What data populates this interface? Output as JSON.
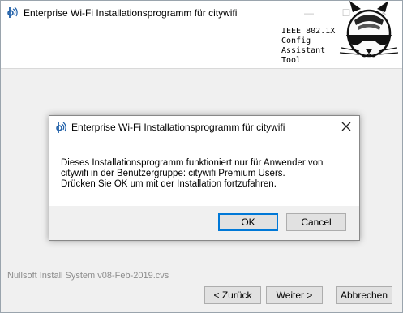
{
  "window": {
    "title": "Enterprise Wi-Fi Installationsprogramm für citywifi",
    "banner_lines": [
      "IEEE 802.1X",
      "Config",
      "Assistant",
      "Tool"
    ],
    "controls": {
      "minimize": "—",
      "maximize": "☐",
      "close": "✕"
    }
  },
  "dialog": {
    "title": "Enterprise Wi-Fi Installationsprogramm für citywifi",
    "message_lines": [
      "Dieses Installationsprogramm funktioniert nur für Anwender von",
      "citywifi in der Benutzergruppe: citywifi Premium Users.",
      "Drücken Sie OK um mit der Installation fortzufahren."
    ],
    "ok_label": "OK",
    "cancel_label": "Cancel",
    "close_glyph": "✕"
  },
  "footer": {
    "system_label": "Nullsoft Install System v08-Feb-2019.cvs",
    "back_label": "< Zurück",
    "next_label": "Weiter >",
    "cancel_label": "Abbrechen"
  },
  "colors": {
    "accent": "#0078d7",
    "window_bg": "#f0f0f0",
    "dialog_bg": "#ffffff"
  },
  "icons": [
    "eduroam-cat-icon",
    "cat-logo-icon",
    "close-icon"
  ]
}
